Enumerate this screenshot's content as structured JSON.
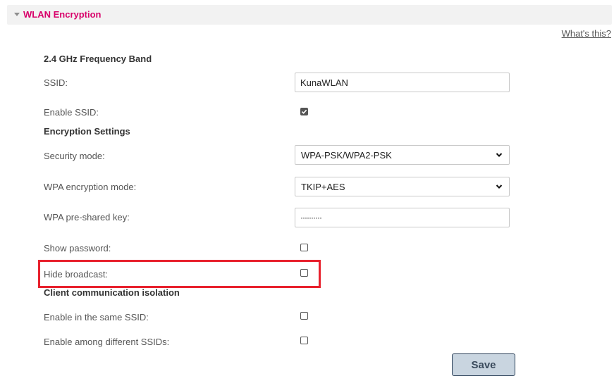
{
  "section": {
    "title": "WLAN Encryption",
    "help_link": "What's this?"
  },
  "band": {
    "heading": "2.4 GHz Frequency Band"
  },
  "ssid": {
    "label": "SSID:",
    "value": "KunaWLAN"
  },
  "enable_ssid": {
    "label": "Enable SSID:",
    "checked": true
  },
  "encryption": {
    "heading": "Encryption Settings"
  },
  "security_mode": {
    "label": "Security mode:",
    "value": "WPA-PSK/WPA2-PSK"
  },
  "wpa_mode": {
    "label": "WPA encryption mode:",
    "value": "TKIP+AES"
  },
  "psk": {
    "label": "WPA pre-shared key:",
    "value": "··········"
  },
  "show_password": {
    "label": "Show password:",
    "checked": false
  },
  "hide_broadcast": {
    "label": "Hide broadcast:",
    "checked": false
  },
  "isolation": {
    "heading": "Client communication isolation"
  },
  "same_ssid": {
    "label": "Enable in the same SSID:",
    "checked": false
  },
  "different_ssids": {
    "label": "Enable among different SSIDs:",
    "checked": false
  },
  "save_label": "Save",
  "colors": {
    "accent": "#d8006a",
    "highlight": "#e8212d",
    "button_bg": "#c9d5e0",
    "button_border": "#2c4159"
  }
}
